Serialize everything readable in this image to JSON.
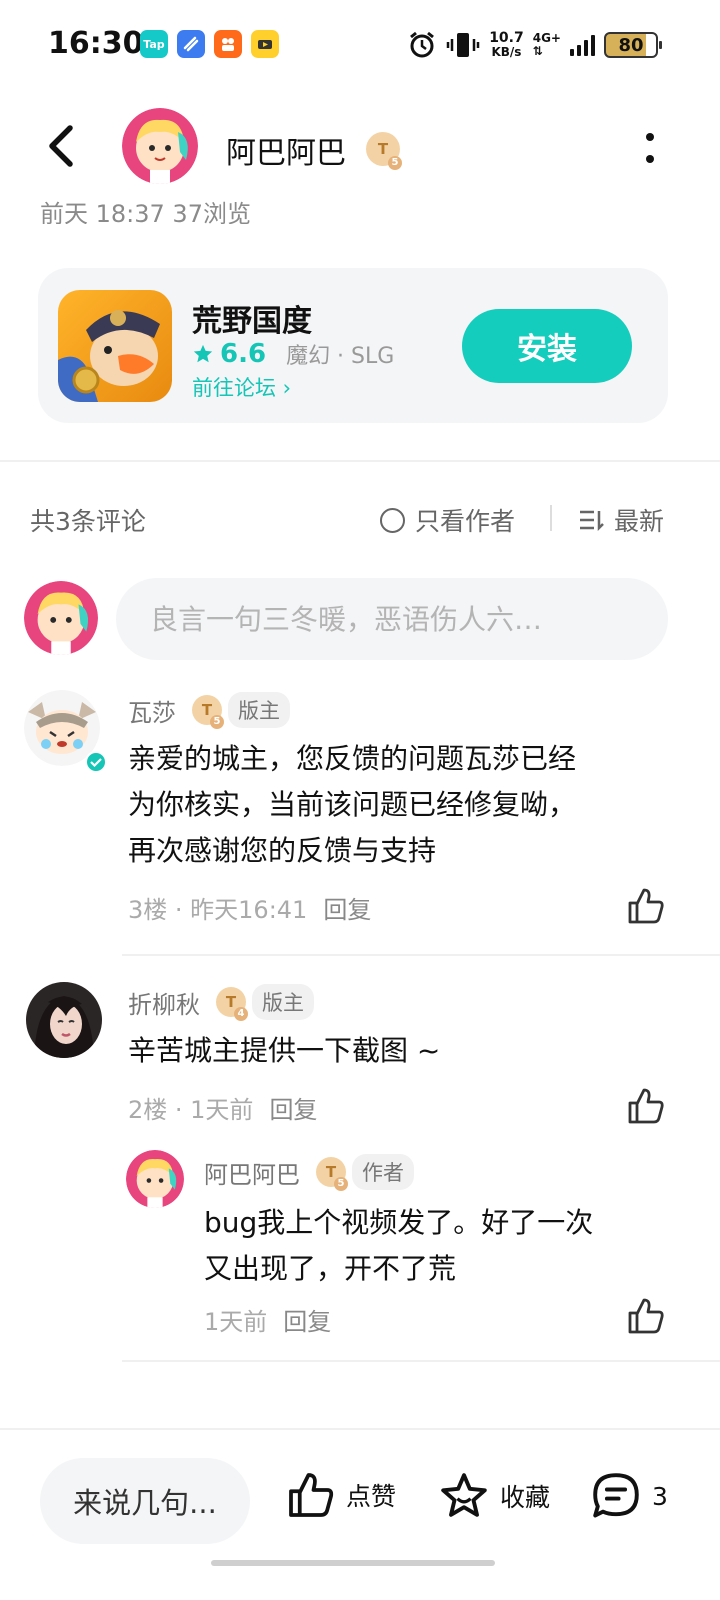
{
  "status_bar": {
    "time": "16:30",
    "apps": [
      "Tap",
      "",
      "",
      ""
    ],
    "net_speed": "10.7",
    "net_speed_unit": "KB/s",
    "network": "4G+",
    "battery": "80"
  },
  "header": {
    "username": "阿巴阿巴",
    "level": "T",
    "level_num": "5"
  },
  "post_meta": "前天 18:37  37浏览",
  "game_card": {
    "name": "荒野国度",
    "rating": "6.6",
    "tags": "魔幻 · SLG",
    "forum_link": "前往论坛 ›",
    "install_label": "安装",
    "accent_color": "#15cdbd"
  },
  "comments_bar": {
    "count_label": "共3条评论",
    "only_author_label": "只看作者",
    "sort_label": "最新"
  },
  "comment_input": {
    "placeholder": "良言一句三冬暖，恶语伤人六…"
  },
  "comments": [
    {
      "name": "瓦莎",
      "level": "T",
      "level_num": "5",
      "role": "版主",
      "text_lines": [
        "亲爱的城主，您反馈的问题瓦莎已经",
        "为你核实，当前该问题已经修复呦，",
        "再次感谢您的反馈与支持"
      ],
      "floor": "3楼 · 昨天16:41",
      "reply_label": "回复"
    },
    {
      "name": "折柳秋",
      "level": "T",
      "level_num": "4",
      "role": "版主",
      "text_lines": [
        "辛苦城主提供一下截图 ~"
      ],
      "floor": "2楼 · 1天前",
      "reply_label": "回复",
      "sub_reply": {
        "name": "阿巴阿巴",
        "level": "T",
        "level_num": "5",
        "role": "作者",
        "text_lines": [
          "bug我上个视频发了。好了一次",
          "又出现了，开不了荒"
        ],
        "time": "1天前",
        "reply_label": "回复"
      }
    }
  ],
  "bottom_bar": {
    "say_label": "来说几句...",
    "like_label": "点赞",
    "fav_label": "收藏",
    "comment_count": "3"
  }
}
